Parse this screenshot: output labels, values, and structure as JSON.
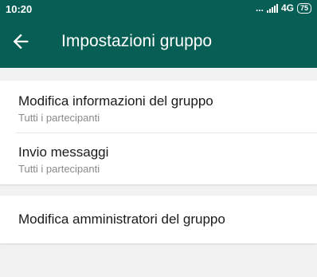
{
  "status_bar": {
    "time": "10:20",
    "dots": "...",
    "network": "4G",
    "network_extra": "",
    "battery": "75"
  },
  "app_bar": {
    "back_icon": "arrow-left-icon",
    "title": "Impostazioni gruppo"
  },
  "settings": {
    "edit_info": {
      "title": "Modifica informazioni del gruppo",
      "subtitle": "Tutti i partecipanti"
    },
    "send_messages": {
      "title": "Invio messaggi",
      "subtitle": "Tutti i partecipanti"
    },
    "edit_admins": {
      "title": "Modifica amministratori del gruppo"
    }
  },
  "colors": {
    "header": "#075e54",
    "highlight": "#fcfb3e",
    "background": "#f2f2f2"
  }
}
